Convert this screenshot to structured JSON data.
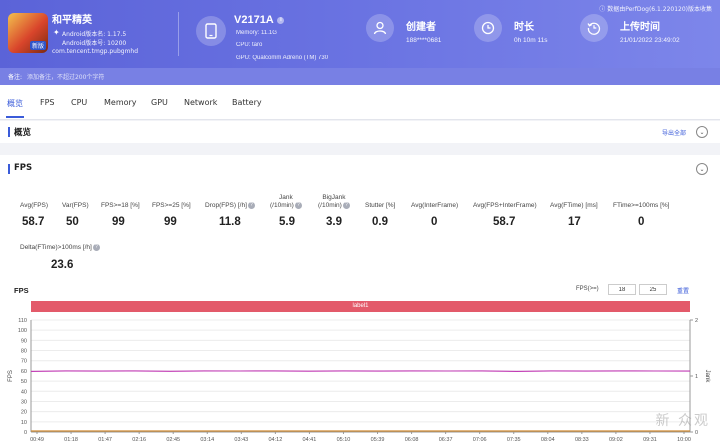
{
  "app": {
    "name": "和平精英",
    "icon_tag": "新版",
    "android_version_label": "Android版本名: 1.17.5",
    "android_version_code": "Android版本号: 10200",
    "package": "com.tencent.tmgp.pubgmhd"
  },
  "device": {
    "name": "V2171A",
    "memory": "Memory: 11.1G",
    "cpu": "CPU: taro",
    "gpu": "GPU: Qualcomm Adreno (TM) 730"
  },
  "creator": {
    "title": "创建者",
    "value": "188****0681"
  },
  "duration": {
    "title": "时长",
    "value": "0h 10m 11s"
  },
  "upload": {
    "title": "上传时间",
    "value": "21/01/2022 23:49:02"
  },
  "source_note": "数据由PerfDog(6.1.220120)版本收集",
  "note": {
    "label": "备注:",
    "placeholder": "添加备注，不超过200个字符"
  },
  "tabs": [
    "概览",
    "FPS",
    "CPU",
    "Memory",
    "GPU",
    "Network",
    "Battery"
  ],
  "overview": {
    "title": "概览",
    "export": "导出全部"
  },
  "fps_section": {
    "title": "FPS"
  },
  "metrics": [
    {
      "label": "Avg(FPS)",
      "value": "58.7"
    },
    {
      "label": "Var(FPS)",
      "value": "50"
    },
    {
      "label": "FPS>=18 [%]",
      "value": "99"
    },
    {
      "label": "FPS>=25 [%]",
      "value": "99"
    },
    {
      "label": "Drop(FPS) [/h]",
      "value": "11.8"
    },
    {
      "label": "Jank",
      "label2": "(/10min)",
      "value": "5.9"
    },
    {
      "label": "BigJank",
      "label2": "(/10min)",
      "value": "3.9"
    },
    {
      "label": "Stutter [%]",
      "value": "0.9"
    },
    {
      "label": "Avg(InterFrame)",
      "value": "0"
    },
    {
      "label": "Avg(FPS+InterFrame)",
      "value": "58.7"
    },
    {
      "label": "Avg(FTime) [ms]",
      "value": "17"
    },
    {
      "label": "FTime>=100ms [%]",
      "value": "0"
    },
    {
      "label": "Delta(FTime)>100ms [/h]",
      "value": "23.6"
    }
  ],
  "chart_controls": {
    "title": "FPS",
    "threshold_label": "FPS(>=)",
    "threshold_1": "18",
    "threshold_2": "25",
    "reset": "重置",
    "band_label": "label1"
  },
  "chart_data": {
    "type": "line",
    "ylabel": "FPS",
    "y2label": "Jank",
    "ylim": [
      0,
      110
    ],
    "y2lim": [
      0,
      2
    ],
    "yticks": [
      0,
      10,
      20,
      30,
      40,
      50,
      60,
      70,
      80,
      90,
      100,
      110
    ],
    "y2ticks": [
      0,
      1,
      2
    ],
    "xticks": [
      "00:49",
      "01:18",
      "01:47",
      "02:16",
      "02:45",
      "03:14",
      "03:43",
      "04:12",
      "04:41",
      "05:10",
      "05:39",
      "06:08",
      "06:37",
      "07:06",
      "07:35",
      "08:04",
      "08:33",
      "09:02",
      "09:31",
      "10:00"
    ],
    "series": [
      {
        "name": "FPS",
        "color": "#c23bb5",
        "values": [
          59.5,
          60,
          59.8,
          60,
          59.6,
          60,
          59.9,
          60,
          59.7,
          60,
          59.8,
          60,
          59.9,
          60,
          59.5,
          60,
          59.8,
          60,
          59.9,
          59.8
        ]
      }
    ],
    "colors": {
      "fps": "#c23bb5",
      "jank": "#d08a33"
    }
  },
  "watermark": "新 众观"
}
